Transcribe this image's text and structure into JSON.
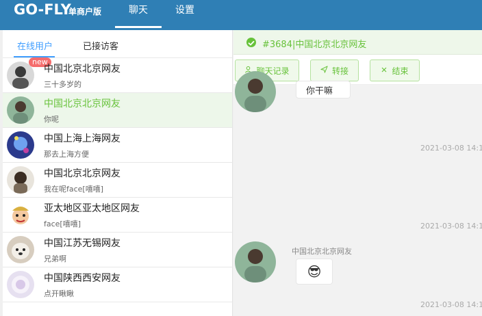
{
  "header": {
    "brand": "GO-FLY",
    "brand_sub": "单商户版",
    "nav": {
      "chat": "聊天",
      "settings": "设置"
    }
  },
  "tabs": {
    "online": "在线用户",
    "visited": "已接访客"
  },
  "users": [
    {
      "name": "中国北京北京网友",
      "msg": "三十多岁的",
      "badge": "new"
    },
    {
      "name": "中国北京北京网友",
      "msg": "你呢"
    },
    {
      "name": "中国上海上海网友",
      "msg": "那去上海方便"
    },
    {
      "name": "中国北京北京网友",
      "msg": "我在呢face[嘻嘻]"
    },
    {
      "name": "亚太地区亚太地区网友",
      "msg": "face[嘻嘻]"
    },
    {
      "name": "中国江苏无锡网友",
      "msg": "兄弟啊"
    },
    {
      "name": "中国陕西西安网友",
      "msg": "点开瞅瞅"
    }
  ],
  "chat": {
    "title": "#3684|中国北京北京网友",
    "actions": {
      "history": "聊天记录",
      "transfer": "转接",
      "end": "结束"
    },
    "top_bubble": "你干嘛",
    "times": [
      "2021-03-08 14:1",
      "2021-03-08 14:1",
      "2021-03-08 14:1"
    ],
    "sender": "中国北京北京网友",
    "emoji": "😎"
  },
  "colors": {
    "topbar": "#2f7fb5",
    "accent_blue": "#409eff",
    "accent_green": "#67c23a"
  },
  "icons": [
    "check-circle-icon",
    "user-icon",
    "send-icon",
    "close-icon"
  ]
}
